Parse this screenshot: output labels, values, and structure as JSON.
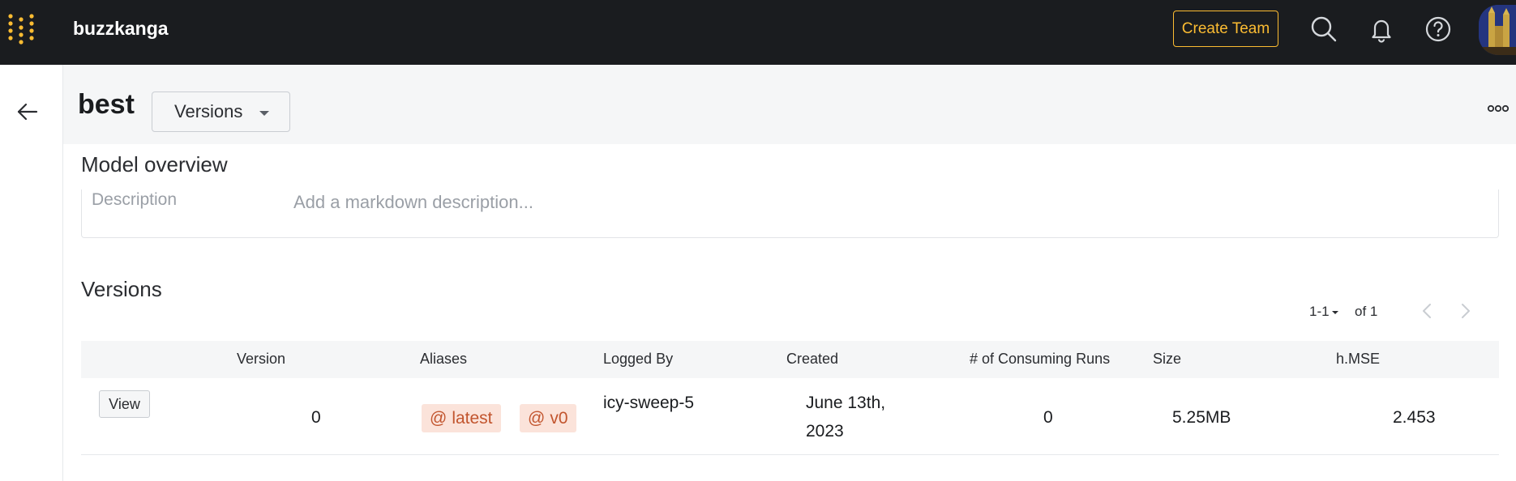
{
  "topbar": {
    "brand": "buzzkanga",
    "create_team_label": "Create Team",
    "accent_color": "#fcbc32",
    "icons": [
      "search-icon",
      "bell-icon",
      "help-icon"
    ]
  },
  "header": {
    "title": "best",
    "view_select": "Versions"
  },
  "overview": {
    "title": "Model overview",
    "description_label": "Description",
    "description_placeholder": "Add a markdown description..."
  },
  "versions": {
    "title": "Versions",
    "pager": {
      "range": "1-1",
      "of": "of 1"
    },
    "columns": [
      "Version",
      "Aliases",
      "Logged By",
      "Created",
      "# of Consuming Runs",
      "Size",
      "h.MSE"
    ],
    "rows": [
      {
        "action": "View",
        "version": "0",
        "aliases": [
          "latest",
          "v0"
        ],
        "logged_by": "icy-sweep-5",
        "created_line1": "June 13th,",
        "created_line2": "2023",
        "consuming_runs": "0",
        "size": "5.25MB",
        "h_mse": "2.453"
      }
    ]
  }
}
